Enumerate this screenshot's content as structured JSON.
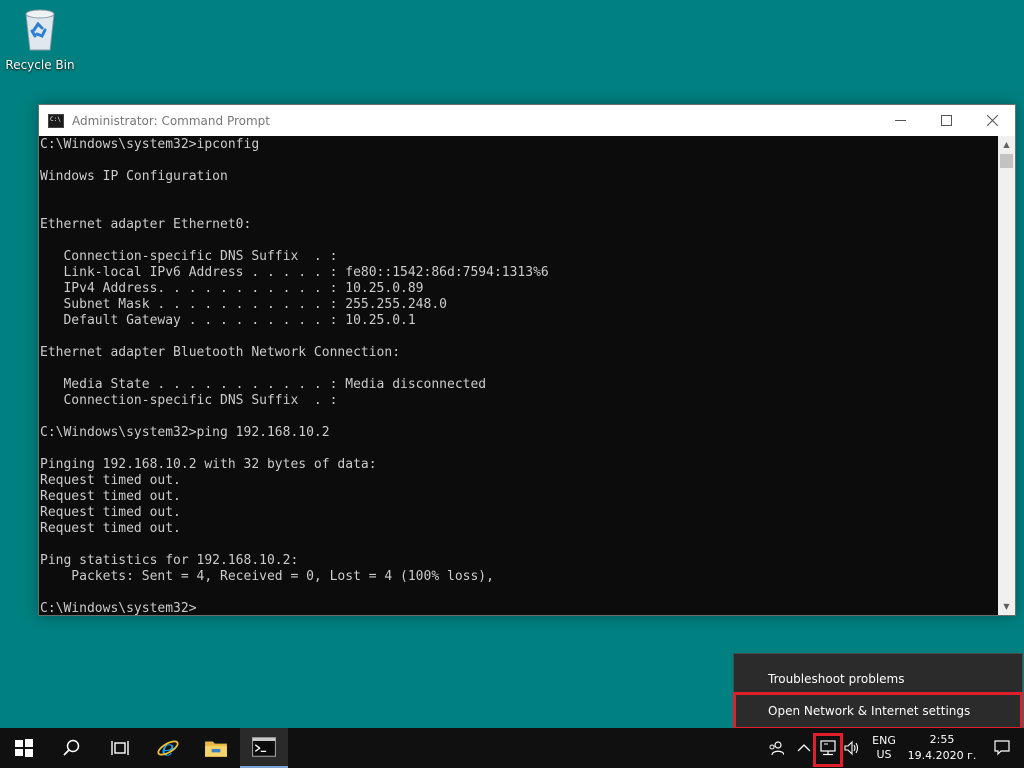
{
  "desktop": {
    "icons": [
      {
        "label": "Recycle Bin",
        "icon": "recycle-bin-icon"
      }
    ]
  },
  "window": {
    "title": "Administrator: Command Prompt",
    "controls": [
      "minimize",
      "maximize",
      "close"
    ]
  },
  "console": {
    "lines": [
      "C:\\Windows\\system32>ipconfig",
      "",
      "Windows IP Configuration",
      "",
      "",
      "Ethernet adapter Ethernet0:",
      "",
      "   Connection-specific DNS Suffix  . :",
      "   Link-local IPv6 Address . . . . . : fe80::1542:86d:7594:1313%6",
      "   IPv4 Address. . . . . . . . . . . : 10.25.0.89",
      "   Subnet Mask . . . . . . . . . . . : 255.255.248.0",
      "   Default Gateway . . . . . . . . . : 10.25.0.1",
      "",
      "Ethernet adapter Bluetooth Network Connection:",
      "",
      "   Media State . . . . . . . . . . . : Media disconnected",
      "   Connection-specific DNS Suffix  . :",
      "",
      "C:\\Windows\\system32>ping 192.168.10.2",
      "",
      "Pinging 192.168.10.2 with 32 bytes of data:",
      "Request timed out.",
      "Request timed out.",
      "Request timed out.",
      "Request timed out.",
      "",
      "Ping statistics for 192.168.10.2:",
      "    Packets: Sent = 4, Received = 0, Lost = 4 (100% loss),",
      "",
      "C:\\Windows\\system32>"
    ]
  },
  "flyout": {
    "troubleshoot_label": "Troubleshoot problems",
    "network_settings_label": "Open Network & Internet settings"
  },
  "taskbar": {
    "pinned": [
      "start-icon",
      "search-icon",
      "task-view-icon",
      "internet-explorer-icon",
      "file-explorer-icon",
      "command-prompt-icon"
    ],
    "tray": {
      "lang_line1": "ENG",
      "lang_line2": "US",
      "time": "2:55",
      "date": "19.4.2020 г."
    }
  },
  "colors": {
    "desktop": "#008080",
    "highlight": "#e01f2a",
    "console_bg": "#0c0c0c",
    "console_text": "#cccccc"
  }
}
